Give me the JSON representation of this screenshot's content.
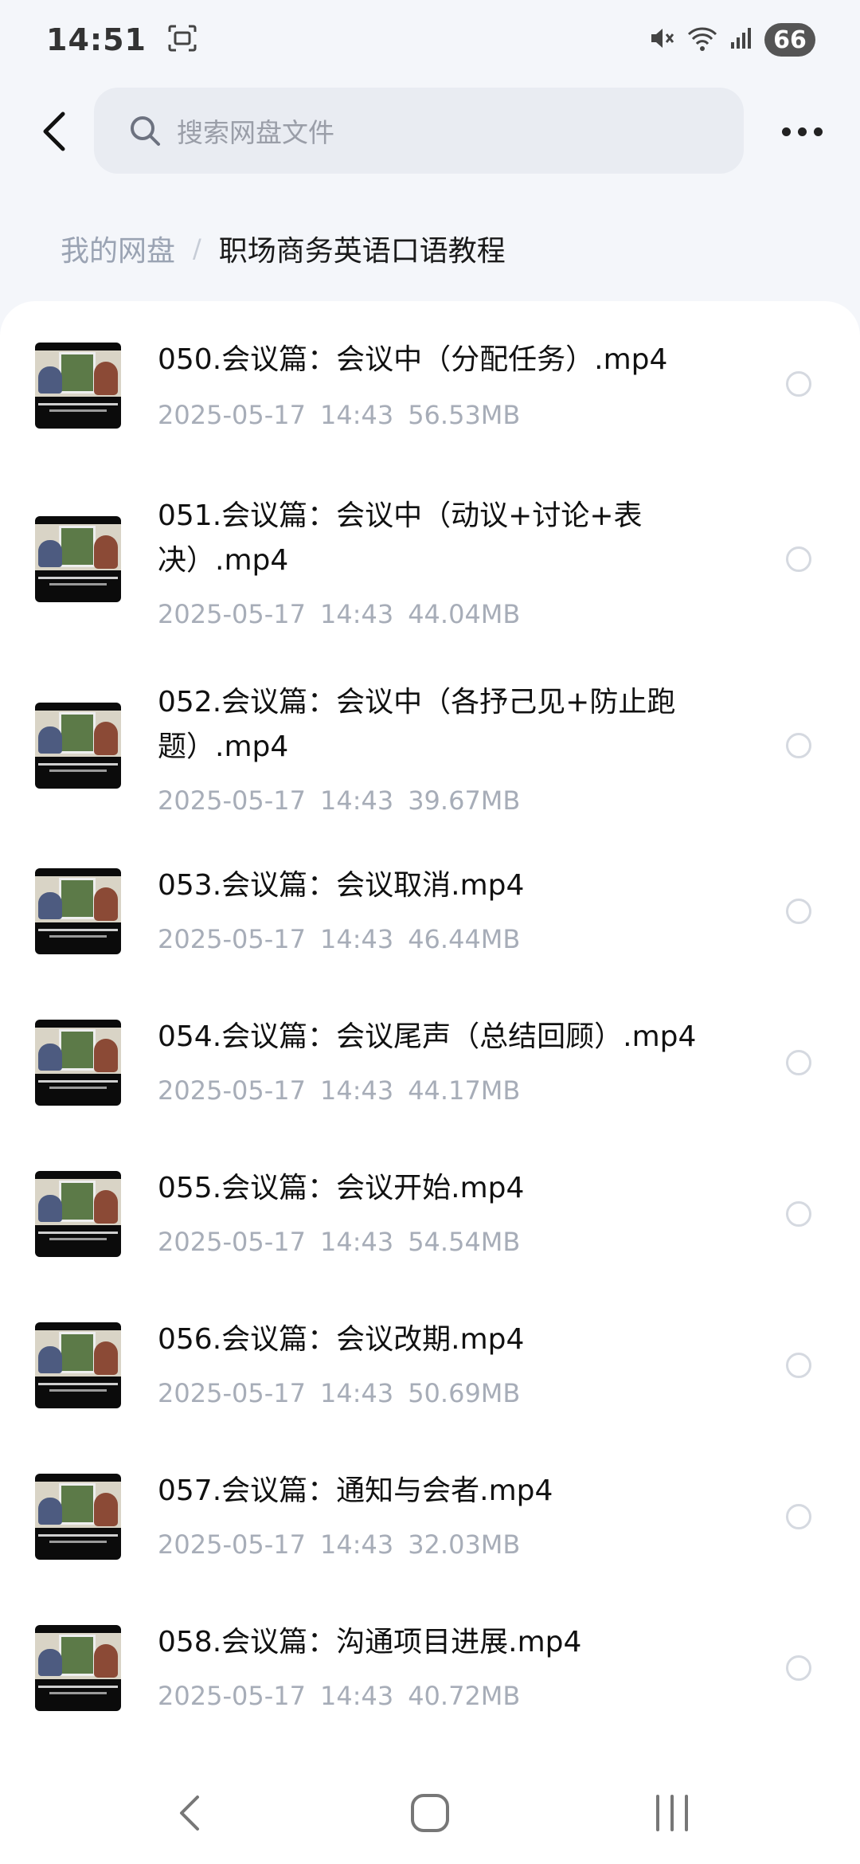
{
  "status_bar": {
    "time": "14:51",
    "battery": "66"
  },
  "search": {
    "placeholder": "搜索网盘文件"
  },
  "breadcrumb": {
    "root": "我的网盘",
    "separator": "/",
    "current": "职场商务英语口语教程"
  },
  "files": [
    {
      "name": "050.会议篇：会议中（分配任务）.mp4",
      "date": "2025-05-17",
      "time": "14:43",
      "size": "56.53MB"
    },
    {
      "name": "051.会议篇：会议中（动议+讨论+表决）.mp4",
      "date": "2025-05-17",
      "time": "14:43",
      "size": "44.04MB"
    },
    {
      "name": "052.会议篇：会议中（各抒己见+防止跑题）.mp4",
      "date": "2025-05-17",
      "time": "14:43",
      "size": "39.67MB"
    },
    {
      "name": "053.会议篇：会议取消.mp4",
      "date": "2025-05-17",
      "time": "14:43",
      "size": "46.44MB"
    },
    {
      "name": "054.会议篇：会议尾声（总结回顾）.mp4",
      "date": "2025-05-17",
      "time": "14:43",
      "size": "44.17MB"
    },
    {
      "name": "055.会议篇：会议开始.mp4",
      "date": "2025-05-17",
      "time": "14:43",
      "size": "54.54MB"
    },
    {
      "name": "056.会议篇：会议改期.mp4",
      "date": "2025-05-17",
      "time": "14:43",
      "size": "50.69MB"
    },
    {
      "name": "057.会议篇：通知与会者.mp4",
      "date": "2025-05-17",
      "time": "14:43",
      "size": "32.03MB"
    },
    {
      "name": "058.会议篇：沟通项目进展.mp4",
      "date": "2025-05-17",
      "time": "14:43",
      "size": "40.72MB"
    }
  ],
  "colors": {
    "accent_bg": "#f4f6fa",
    "meta_text": "#a7adb8",
    "search_bg": "#e9ecf2"
  }
}
